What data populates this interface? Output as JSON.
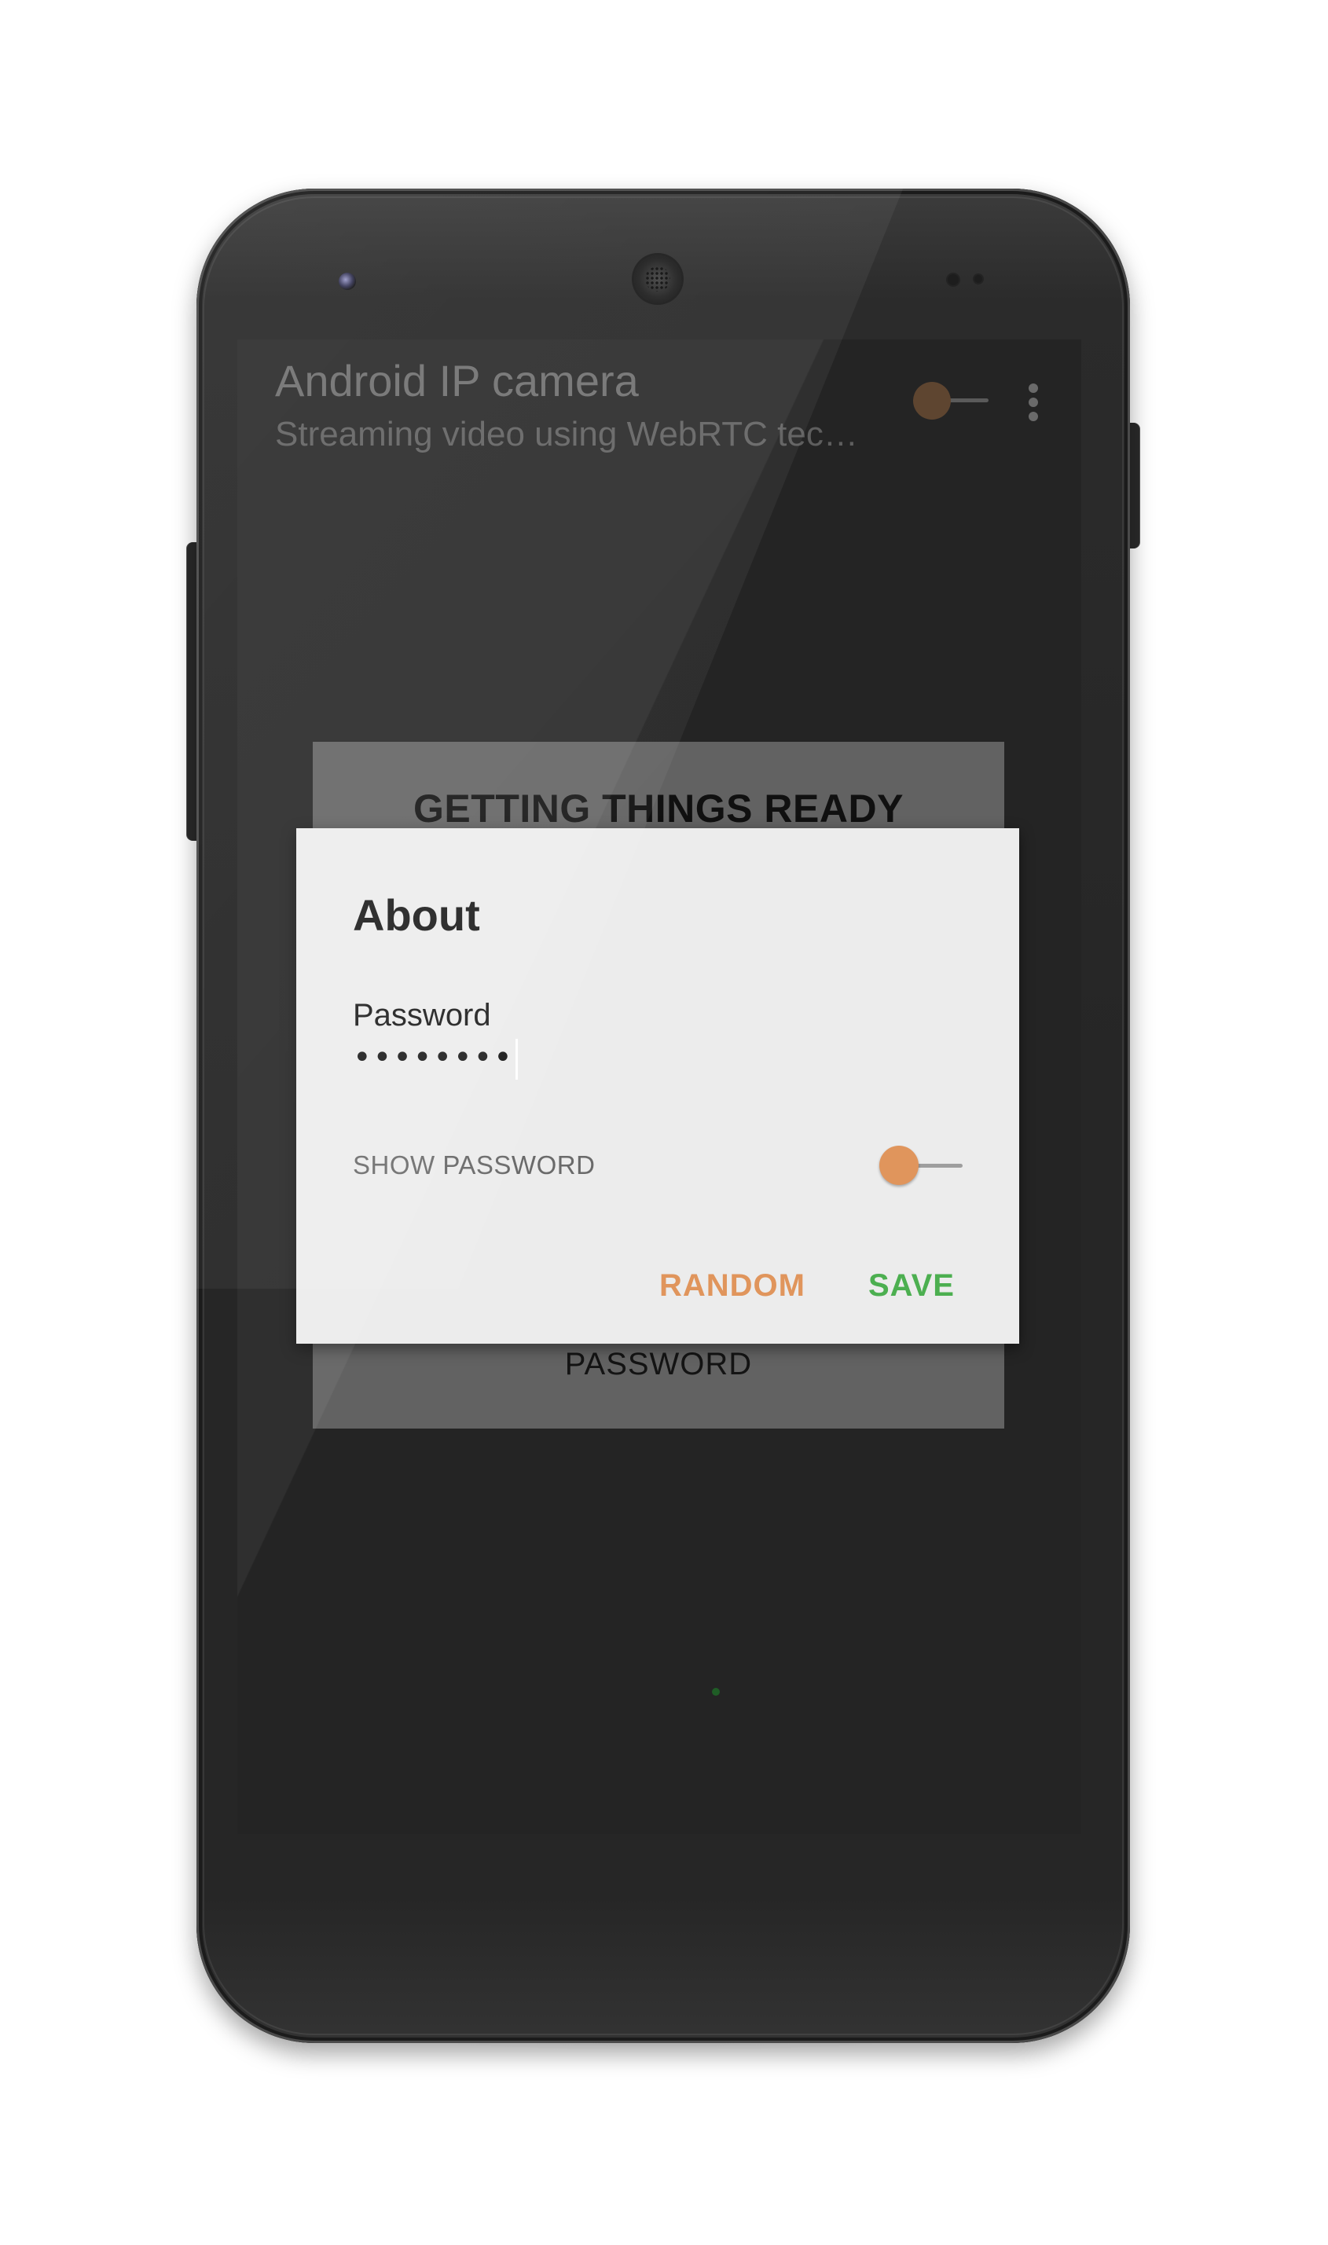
{
  "app": {
    "title": "Android IP camera",
    "subtitle": "Streaming video using WebRTC tec…"
  },
  "background_card": {
    "title": "GETTING THINGS READY",
    "password_label": "PASSWORD"
  },
  "dialog": {
    "title": "About",
    "password_field": {
      "label": "Password",
      "masked_value": "••••••••"
    },
    "show_password": {
      "label": "SHOW PASSWORD",
      "checked": false
    },
    "buttons": {
      "random": "RANDOM",
      "save": "SAVE"
    }
  },
  "colors": {
    "accent_orange": "#e0955c",
    "accent_green": "#4caf50",
    "dialog_bg": "#ececec",
    "screen_bg": "#242424"
  },
  "icons": {
    "overflow": "overflow-menu-icon",
    "front_camera": "front-camera",
    "earpiece": "earpiece-speaker"
  }
}
